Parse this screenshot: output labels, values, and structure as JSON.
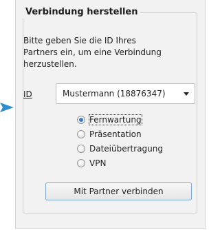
{
  "group": {
    "title": "Verbindung herstellen",
    "description": "Bitte geben Sie die ID Ihres\nPartners ein, um eine Verbindung\nherzustellen."
  },
  "id_field": {
    "label": "ID",
    "value": "Mustermann (18876347)"
  },
  "connection_modes": [
    {
      "label": "Fernwartung",
      "checked": true
    },
    {
      "label": "Präsentation",
      "checked": false
    },
    {
      "label": "Dateiübertragung",
      "checked": false
    },
    {
      "label": "VPN",
      "checked": false
    }
  ],
  "connect_button": {
    "label": "Mit Partner verbinden"
  },
  "colors": {
    "pointer_arrow": "#2e8fd6",
    "radio_selected": "#3d7ec5",
    "button_border": "#7aa7d9"
  },
  "icons": {
    "pointer": "pointer-arrow-icon",
    "dropdown": "chevron-down-icon"
  }
}
